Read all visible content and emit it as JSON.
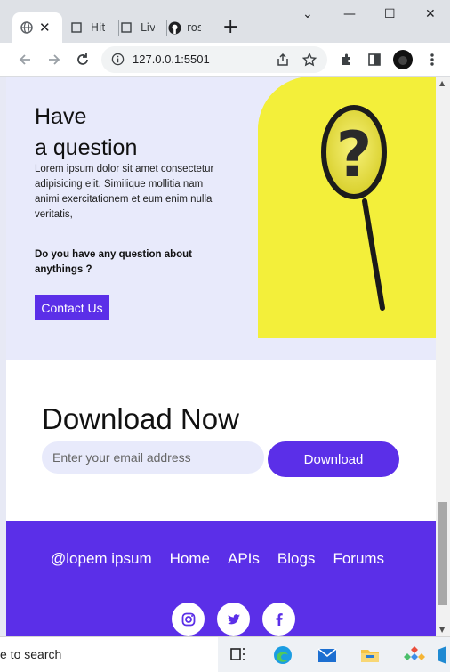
{
  "browser": {
    "tabs": [
      {
        "label": "",
        "active": true
      },
      {
        "label": "Hit"
      },
      {
        "label": "Liv"
      },
      {
        "label": "ros"
      }
    ],
    "url": "127.0.0.1:5501"
  },
  "question": {
    "title_line1": "Have",
    "title_line2": "a question",
    "body": "Lorem ipsum dolor sit amet consectetur adipisicing elit. Similique mollitia nam animi exercitationem et eum enim nulla veritatis,",
    "prompt": "Do you have any question about anythings ?",
    "cta": "Contact Us"
  },
  "download": {
    "title": "Download Now",
    "email_placeholder": "Enter your email address",
    "button": "Download"
  },
  "footer": {
    "nav": [
      "@lopem ipsum",
      "Home",
      "APIs",
      "Blogs",
      "Forums"
    ],
    "social": [
      "instagram-icon",
      "twitter-icon",
      "facebook-icon"
    ]
  },
  "taskbar": {
    "search_text": "e to search"
  },
  "colors": {
    "accent": "#5b2fe8",
    "section_bg": "#e8eafb",
    "image_yellow": "#f3ef3a"
  }
}
